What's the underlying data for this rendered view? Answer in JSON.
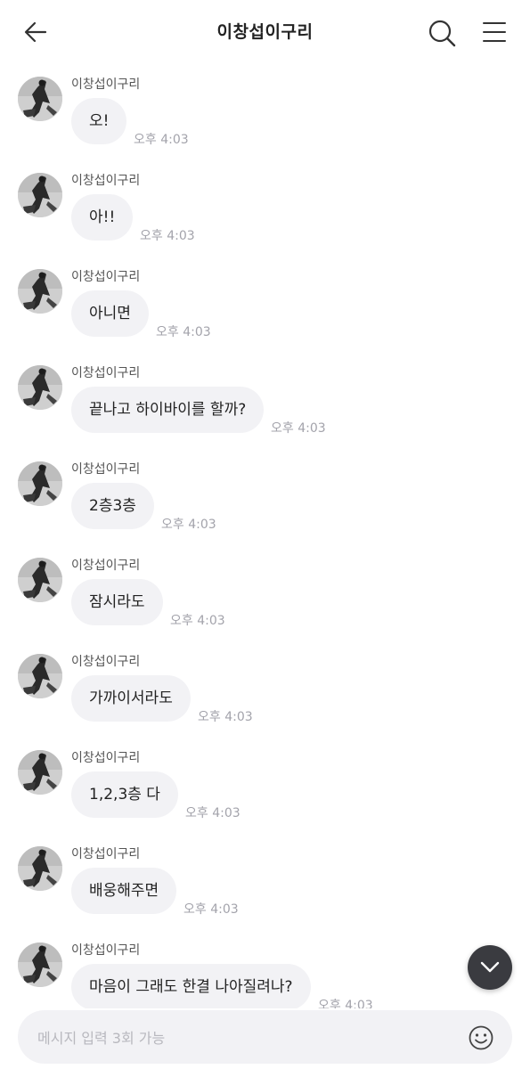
{
  "header": {
    "title": "이창섭이구리",
    "back_icon": "arrow-left-icon",
    "search_icon": "search-icon",
    "menu_icon": "hamburger-menu-icon"
  },
  "messages": [
    {
      "sender": "이창섭이구리",
      "text": "오!",
      "time": "오후 4:03"
    },
    {
      "sender": "이창섭이구리",
      "text": "아!!",
      "time": "오후 4:03"
    },
    {
      "sender": "이창섭이구리",
      "text": "아니면",
      "time": "오후 4:03"
    },
    {
      "sender": "이창섭이구리",
      "text": "끝나고 하이바이를 할까?",
      "time": "오후 4:03"
    },
    {
      "sender": "이창섭이구리",
      "text": "2층3층",
      "time": "오후 4:03"
    },
    {
      "sender": "이창섭이구리",
      "text": "잠시라도",
      "time": "오후 4:03"
    },
    {
      "sender": "이창섭이구리",
      "text": "가까이서라도",
      "time": "오후 4:03"
    },
    {
      "sender": "이창섭이구리",
      "text": "1,2,3층 다",
      "time": "오후 4:03"
    },
    {
      "sender": "이창섭이구리",
      "text": "배웅해주면",
      "time": "오후 4:03"
    },
    {
      "sender": "이창섭이구리",
      "text": "마음이 그래도 한결 나아질려나?",
      "time": "오후 4:03"
    }
  ],
  "input": {
    "placeholder": "메시지 입력 3회 가능",
    "emoji_icon": "smiley-icon"
  },
  "scroll_down_icon": "chevron-down-icon",
  "colors": {
    "bubble": "#f2f2f5",
    "time": "#a3a3ab",
    "fab": "#3a3b40"
  }
}
